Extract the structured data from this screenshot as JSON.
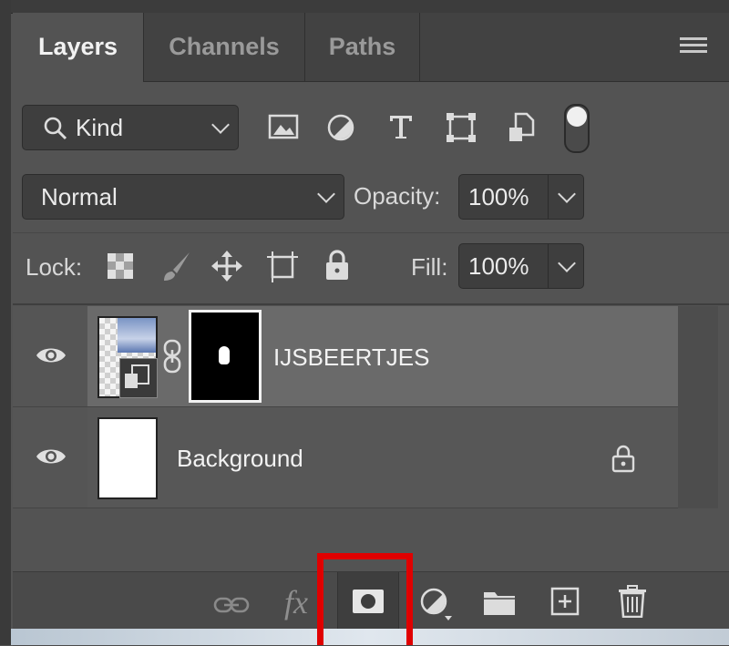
{
  "tabs": [
    {
      "label": "Layers",
      "active": true
    },
    {
      "label": "Channels",
      "active": false
    },
    {
      "label": "Paths",
      "active": false
    }
  ],
  "filter": {
    "kind_label": "Kind",
    "icons": [
      "image-filter-icon",
      "adjustment-filter-icon",
      "type-filter-icon",
      "shape-filter-icon",
      "smart-object-filter-icon",
      "filter-toggle-icon"
    ]
  },
  "blend": {
    "mode": "Normal",
    "opacity_label": "Opacity:",
    "opacity_value": "100%"
  },
  "lock": {
    "label": "Lock:",
    "fill_label": "Fill:",
    "fill_value": "100%"
  },
  "layers": [
    {
      "name": "IJSBEERTJES",
      "selected": true,
      "visible": true
    },
    {
      "name": "Background",
      "selected": false,
      "visible": true,
      "locked": true
    }
  ],
  "footer": {
    "fx_label": "fx"
  },
  "colors": {
    "panel": "#535353",
    "selected_row": "#6a6a6a",
    "highlight": "#e00000"
  }
}
